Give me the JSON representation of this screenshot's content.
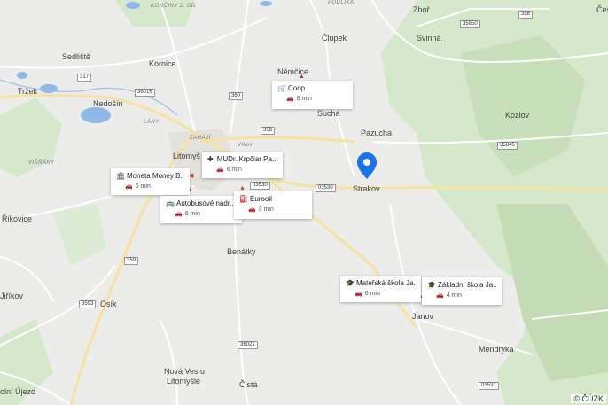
{
  "places": {
    "zhor": "Zhoř",
    "cesk": "Češ",
    "sedliste": "Sedliště",
    "kornice": "Kornice",
    "clupek": "Člupek",
    "svinna": "Svinná",
    "trzek": "Tržek",
    "nedosin": "Nedošín",
    "nemcice": "Němčice",
    "kozlov": "Kozlov",
    "sucha": "Suchá",
    "pazucha": "Pazucha",
    "litomysl": "Litomyš",
    "strakov": "Strakov",
    "rikovice": "Řikovice",
    "benatky": "Benátky",
    "jirikov": "Jiříkov",
    "osik": "Osík",
    "janov": "Janov",
    "mendryka": "Mendryka",
    "nova_ves": "Nová Ves u",
    "nova_ves2": "Litomyšle",
    "cista": "Čistá",
    "olni_ujezd": "olní Újezd"
  },
  "small_labels": {
    "koniny": "KONČINY 2. DÍL",
    "lany": "LÁNY",
    "zahaji": "ZAHÁJÍ",
    "vistraby": "VIŠŇÁRY",
    "vlkov": "Vlkov",
    "podlicka": "PODLÍKA"
  },
  "shields": {
    "r317": "317",
    "r36016": "36016",
    "r360": "360",
    "r358a": "358",
    "r358b": "358",
    "r35850": "35850",
    "r35846": "35846",
    "r03530a": "03530",
    "r03530b": "03530",
    "r359": "359",
    "r3593": "3593",
    "r36021": "36021",
    "r03531": "03531"
  },
  "cards": [
    {
      "icon": "cart-icon",
      "glyph": "🛒",
      "title": "Coop",
      "time": "8 min"
    },
    {
      "icon": "hospital-icon",
      "glyph": "✚",
      "title": "MUDr. Krpčiar Pa...",
      "time": "6 min"
    },
    {
      "icon": "bank-icon",
      "glyph": "🏛",
      "title": "Moneta Money B...",
      "time": "6 min"
    },
    {
      "icon": "bus-icon",
      "glyph": "🚌",
      "title": "Autobusové nádr...",
      "time": "6 min"
    },
    {
      "icon": "fuel-icon",
      "glyph": "⛽",
      "title": "Eurooil",
      "time": "3 min"
    },
    {
      "icon": "school-icon",
      "glyph": "🎓",
      "title": "Mateřská škola Ja...",
      "time": "6 min"
    },
    {
      "icon": "school-icon",
      "glyph": "🎓",
      "title": "Základní škola Ja...",
      "time": "4 min"
    }
  ],
  "car_glyph": "🚗",
  "copyright": "© ČÚZK",
  "colors": {
    "background": "#ececea",
    "forest": "#cfe3c4",
    "water": "#8fb8e8",
    "road": "#ffffff",
    "main_road": "#f7e3a1",
    "pin": "#1a73e8"
  }
}
